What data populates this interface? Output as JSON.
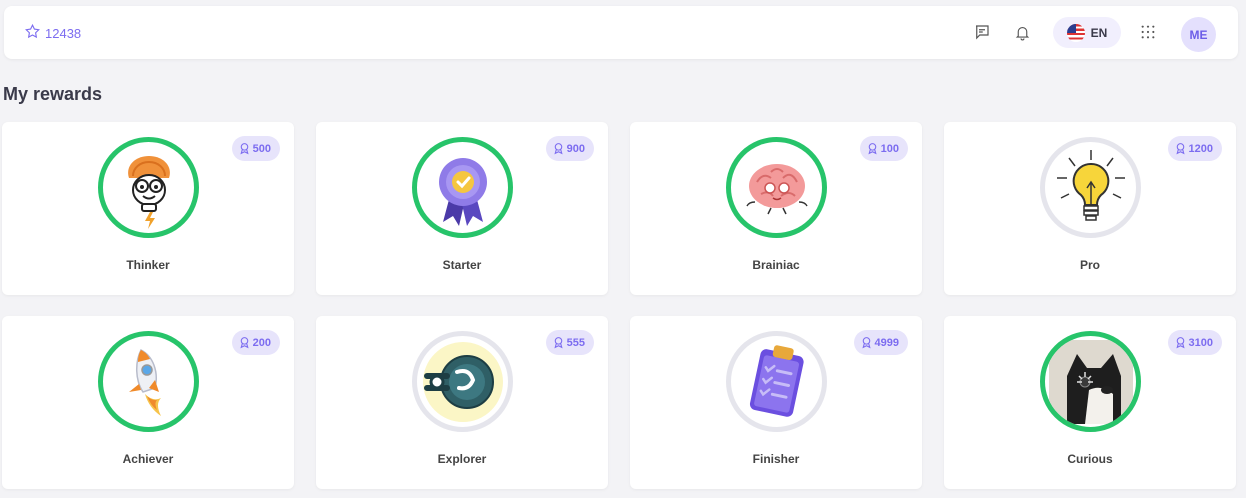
{
  "header": {
    "points_value": "12438",
    "points_icon": "star-outline-icon",
    "language_code": "EN",
    "language_flag": "us-flag-icon",
    "avatar_initials": "ME",
    "icons": [
      "message-icon",
      "bell-icon",
      "apps-grid-icon"
    ]
  },
  "page": {
    "title": "My rewards"
  },
  "rewards": [
    {
      "name": "Thinker",
      "points": "500",
      "unlocked": true,
      "icon": "lightbulb-brain-character-icon"
    },
    {
      "name": "Starter",
      "points": "900",
      "unlocked": true,
      "icon": "ribbon-badge-icon"
    },
    {
      "name": "Brainiac",
      "points": "100",
      "unlocked": true,
      "icon": "meditating-brain-icon"
    },
    {
      "name": "Pro",
      "points": "1200",
      "unlocked": false,
      "icon": "glowing-lightbulb-icon"
    },
    {
      "name": "Achiever",
      "points": "200",
      "unlocked": true,
      "icon": "rocket-icon"
    },
    {
      "name": "Explorer",
      "points": "555",
      "unlocked": false,
      "icon": "compass-circuit-icon"
    },
    {
      "name": "Finisher",
      "points": "4999",
      "unlocked": false,
      "icon": "clipboard-checklist-icon"
    },
    {
      "name": "Curious",
      "points": "3100",
      "unlocked": true,
      "icon": "cat-photo-icon"
    }
  ],
  "colors": {
    "accent": "#7c6cf0",
    "unlocked_ring": "#27c46a",
    "locked_ring": "#e5e5ec",
    "badge_bg": "#e7e4fb"
  }
}
